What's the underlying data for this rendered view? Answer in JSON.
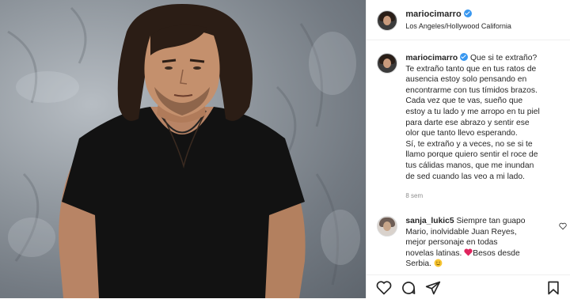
{
  "post": {
    "username": "mariocimarro",
    "location": "Los Angeles/Hollywood California",
    "caption_lines": [
      " Que si te extraño?",
      "Te extraño tanto que en tus ratos de",
      "ausencia estoy solo pensando en",
      "encontrarme con tus tímidos brazos.",
      "Cada vez que te vas, sueño que",
      "estoy a tu lado y me arropo en tu piel",
      "para darte ese abrazo y sentir ese",
      "olor que tanto llevo esperando.",
      "Sí, te extraño y a veces, no se si te",
      "llamo porque quiero sentir el roce de",
      "tus cálidas manos, que me inundan",
      "de sed cuando las veo a mi lado."
    ],
    "time_ago": "8 sem"
  },
  "comment": {
    "username": "sanja_lukic5",
    "lines": [
      " Siempre tan guapo",
      "Mario, inolvidable Juan Reyes,",
      "mejor personaje en todas",
      "novelas latinas. ",
      "Besos desde",
      "Serbia. "
    ]
  },
  "colors": {
    "verified": "#3897f0",
    "heart_emoji": "#e0245e",
    "border": "#efefef",
    "meta": "#8e8e8e"
  },
  "icons": [
    "verified-badge-icon",
    "heart-icon",
    "comment-icon",
    "share-icon",
    "bookmark-icon",
    "red-heart-emoji-icon",
    "smile-emoji-icon"
  ]
}
